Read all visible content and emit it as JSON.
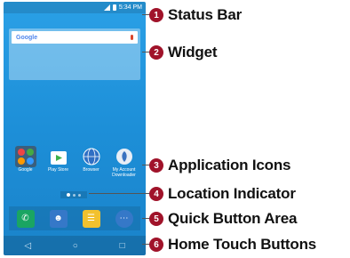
{
  "status_bar": {
    "time": "5:34 PM"
  },
  "widget": {
    "search_logo": "Google"
  },
  "apps": [
    {
      "label": "Google",
      "icon": "google-folder-icon",
      "color": "#3a5f7d"
    },
    {
      "label": "Play Store",
      "icon": "play-store-icon",
      "color": "#1d8fd8"
    },
    {
      "label": "Browser",
      "icon": "browser-globe-icon",
      "color": "#1d8fd8"
    },
    {
      "label": "My Account Downloader",
      "icon": "download-icon",
      "color": "#1d8fd8"
    }
  ],
  "quick_buttons": [
    {
      "name": "phone",
      "color": "#1aa562"
    },
    {
      "name": "contacts",
      "color": "#3578c8"
    },
    {
      "name": "messaging",
      "color": "#f2c12e"
    },
    {
      "name": "apps",
      "color": "#3578c8"
    }
  ],
  "callouts": [
    {
      "number": "1",
      "label": "Status Bar"
    },
    {
      "number": "2",
      "label": "Widget"
    },
    {
      "number": "3",
      "label": "Application Icons"
    },
    {
      "number": "4",
      "label": "Location Indicator"
    },
    {
      "number": "5",
      "label": "Quick Button Area"
    },
    {
      "number": "6",
      "label": "Home Touch Buttons"
    }
  ]
}
